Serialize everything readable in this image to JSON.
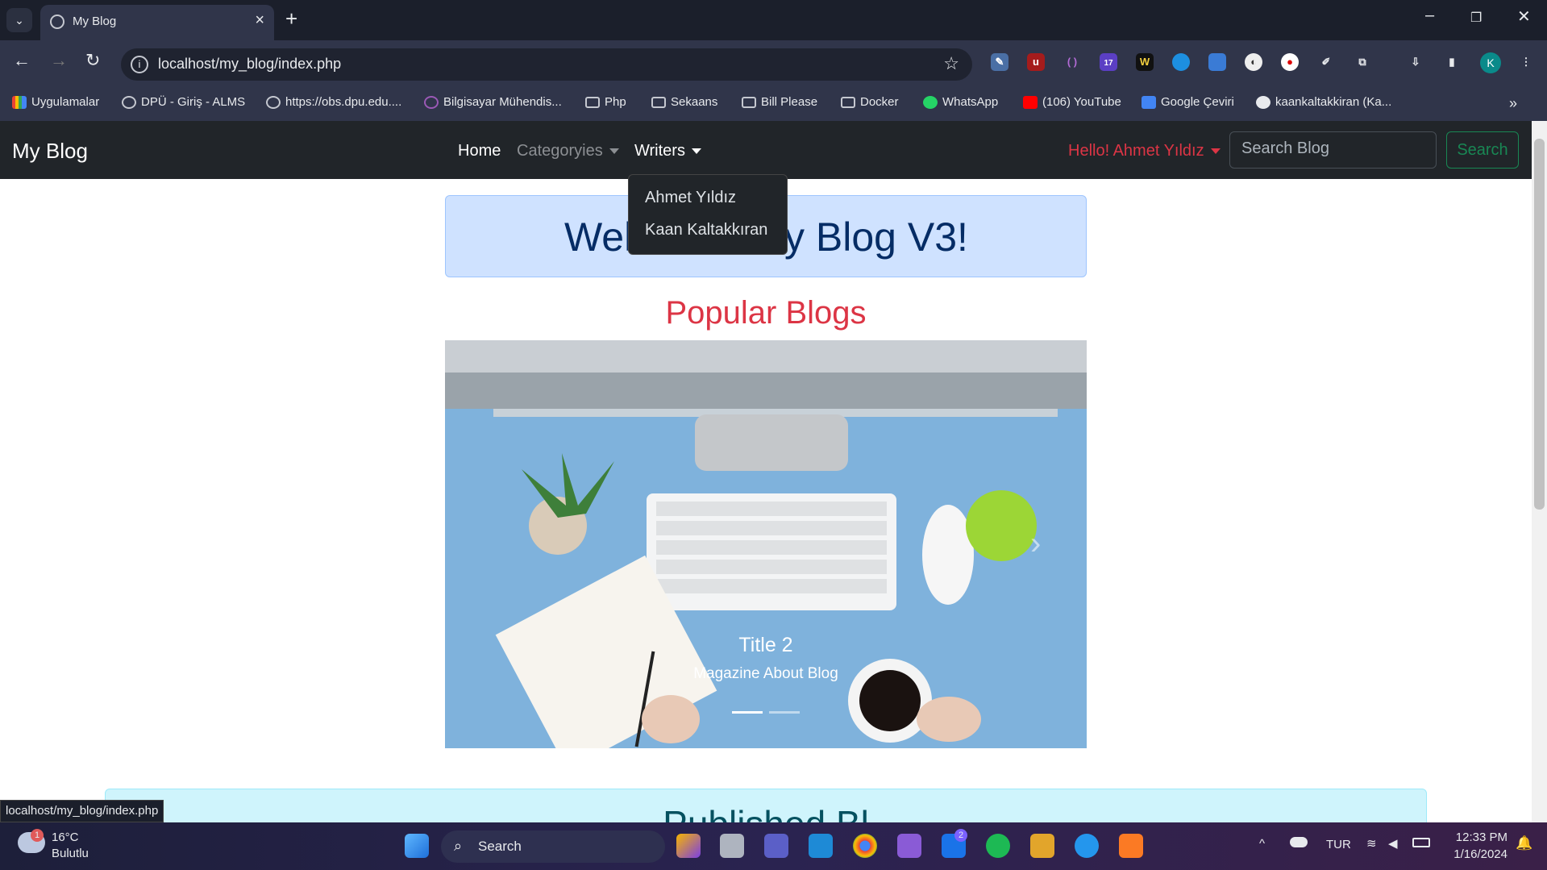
{
  "browser": {
    "tab_title": "My Blog",
    "url": "localhost/my_blog/index.php",
    "avatar_letter": "K",
    "ext_badge": "17",
    "bookmarks": [
      {
        "label": "Uygulamalar",
        "icon": "apps-grid-icon"
      },
      {
        "label": "DPÜ - Giriş - ALMS",
        "icon": "globe-icon"
      },
      {
        "label": "https://obs.dpu.edu....",
        "icon": "globe-icon"
      },
      {
        "label": "Bilgisayar Mühendis...",
        "icon": "site-icon"
      },
      {
        "label": "Php",
        "icon": "folder-icon"
      },
      {
        "label": "Sekaans",
        "icon": "folder-icon"
      },
      {
        "label": "Bill Please",
        "icon": "folder-icon"
      },
      {
        "label": "Docker",
        "icon": "folder-icon"
      },
      {
        "label": "WhatsApp",
        "icon": "whatsapp-icon"
      },
      {
        "label": "(106) YouTube",
        "icon": "youtube-icon"
      },
      {
        "label": "Google Çeviri",
        "icon": "translate-icon"
      },
      {
        "label": "kaankaltakkiran (Ka...",
        "icon": "github-icon"
      }
    ]
  },
  "navbar": {
    "brand": "My Blog",
    "home": "Home",
    "categories": "Categoryies",
    "writers": "Writers",
    "user": "Hello! Ahmet Yıldız",
    "search_placeholder": "Search Blog",
    "search_button": "Search",
    "writers_menu": [
      "Ahmet Yıldız",
      "Kaan Kaltakkıran"
    ]
  },
  "main": {
    "welcome_left": "Wel",
    "welcome_right": "y Blog V3!",
    "popular_heading": "Popular Blogs",
    "carousel": {
      "title": "Title 2",
      "caption": "Magazine About Blog",
      "active_slide": 1,
      "slide_count": 2
    },
    "published_heading": "Published Bl"
  },
  "status_url": "localhost/my_blog/index.php",
  "taskbar": {
    "weather_temp": "16°C",
    "weather_desc": "Bulutlu",
    "weather_badge": "1",
    "search_label": "Search",
    "mail_badge": "2",
    "language": "TUR",
    "time": "12:33 PM",
    "date": "1/16/2024"
  },
  "colors": {
    "danger": "#dc3545",
    "success": "#198754",
    "navbar": "#212529",
    "primary_bg": "#cfe2ff"
  }
}
